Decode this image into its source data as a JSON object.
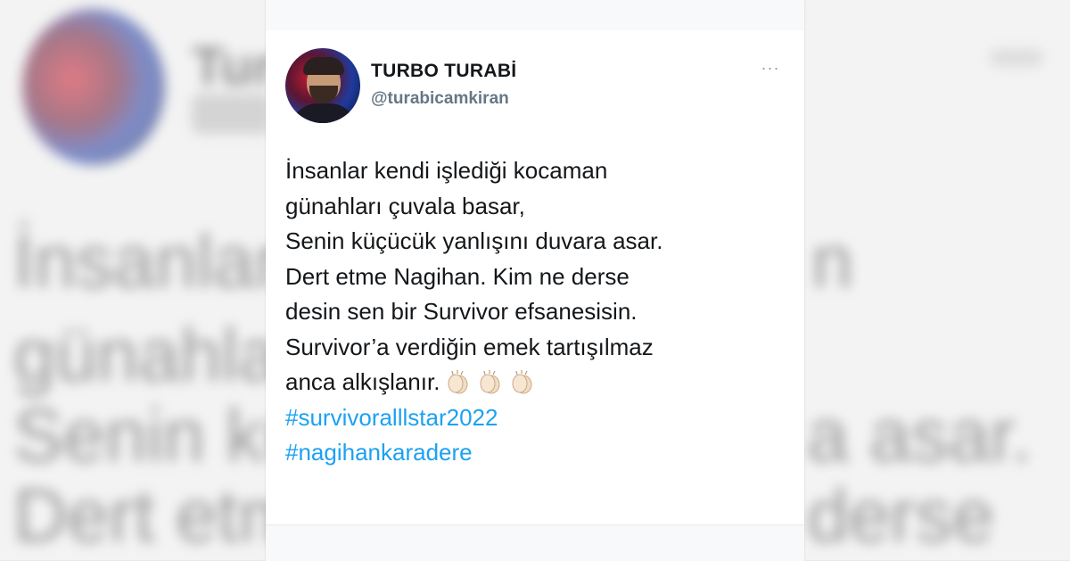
{
  "author": {
    "display_name": "TURBO TURABİ",
    "handle": "@turabicamkiran"
  },
  "more_menu": "···",
  "tweet": {
    "lines": [
      "İnsanlar kendi işlediği kocaman",
      "günahları çuvala basar,",
      "Senin küçücük yanlışını duvara asar.",
      "Dert etme Nagihan. Kim ne derse",
      "desin sen bir Survivor efsanesisin.",
      "Survivor’a verdiğin emek tartışılmaz",
      "anca alkışlanır."
    ],
    "emoji": [
      "clapping-hands-emoji",
      "clapping-hands-emoji",
      "clapping-hands-emoji"
    ],
    "hashtags": [
      "#survivoralllstar2022",
      "#nagihankaradere"
    ]
  },
  "background": {
    "name_fragment": "Turb",
    "lines": [
      "İnsanlar k",
      "günahları",
      "Senin küç",
      "Dert etme"
    ],
    "lines_right": [
      "n",
      "",
      "a asar.",
      "derse"
    ]
  },
  "colors": {
    "hashtag": "#1da1f2",
    "text": "#14171a",
    "handle": "#657786"
  }
}
